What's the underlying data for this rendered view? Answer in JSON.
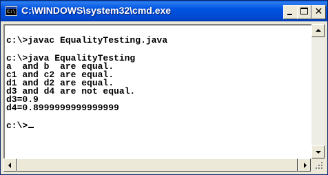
{
  "window": {
    "title": "C:\\WINDOWS\\system32\\cmd.exe",
    "icon_name": "cmd-console-icon",
    "icon_text": "C:\\"
  },
  "titlebar_buttons": {
    "minimize_icon": "minimize-icon",
    "maximize_icon": "maximize-icon",
    "close_icon": "close-icon",
    "close_glyph": "✕"
  },
  "console": {
    "lines": [
      "",
      "c:\\>javac EqualityTesting.java",
      "",
      "c:\\>java EqualityTesting",
      "a  and b  are equal.",
      "c1 and c2 are equal.",
      "d1 and d2 are equal.",
      "d3 and d4 are not equal.",
      "d3=0.9",
      "d4=0.8999999999999999",
      "",
      "c:\\>"
    ],
    "text_color": "#000000",
    "background": "#ffffff"
  },
  "colors": {
    "titlebar": "#0053e1",
    "chrome": "#ece9d8"
  }
}
